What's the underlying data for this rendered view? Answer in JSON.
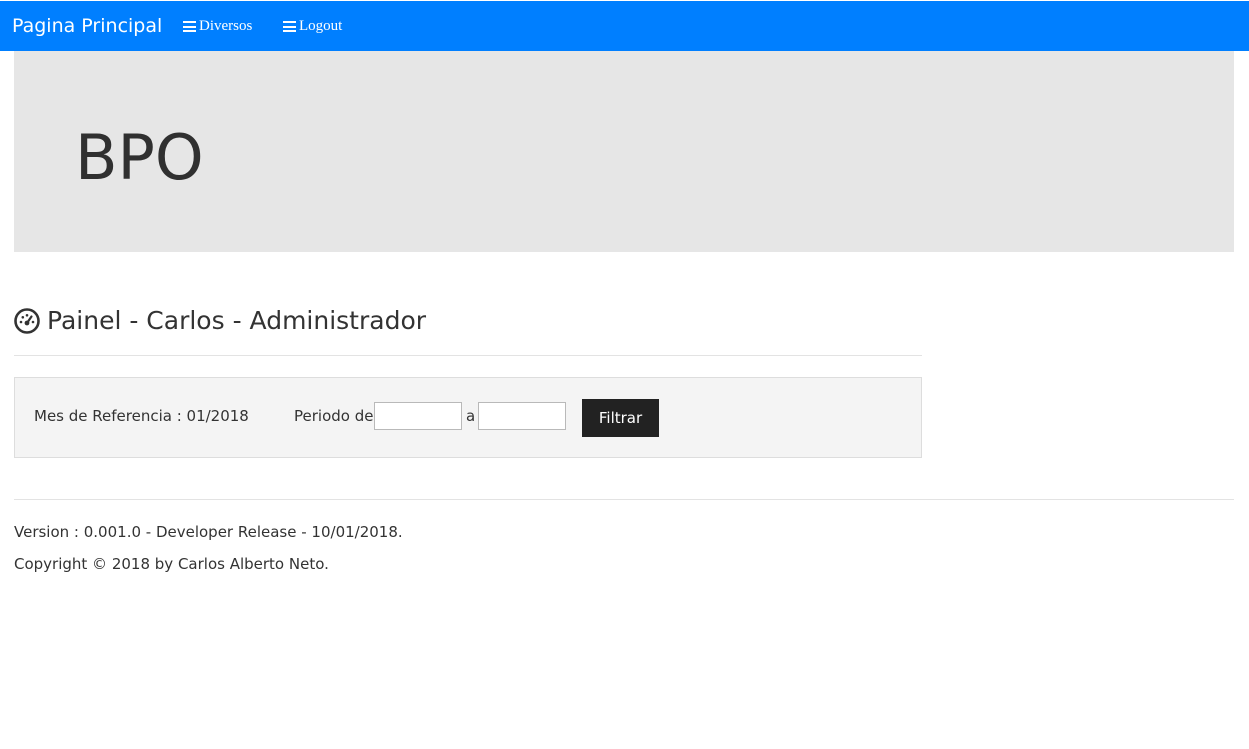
{
  "navbar": {
    "brand": "Pagina Principal",
    "items": [
      {
        "label": "Diversos",
        "icon": "bars-icon"
      },
      {
        "label": "Logout",
        "icon": "bars-icon"
      }
    ],
    "background": "#007fff"
  },
  "jumbotron": {
    "title": "BPO",
    "background": "#e6e6e6"
  },
  "heading": {
    "icon": "dashboard-icon",
    "title": "Painel - Carlos - Administrador"
  },
  "filter": {
    "reference_label": "Mes de Referencia : 01/2018",
    "periodo_label": "Periodo de",
    "date_from": "",
    "separator": "a",
    "date_to": "",
    "button_label": "Filtrar",
    "button_color": "#222222"
  },
  "footer": {
    "version": "Version : 0.001.0 - Developer Release - 10/01/2018.",
    "copyright": "Copyright © 2018 by Carlos Alberto Neto."
  }
}
